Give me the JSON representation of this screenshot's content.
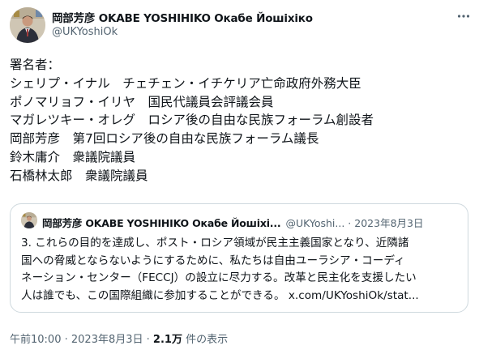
{
  "author": {
    "display_name": "岡部芳彦 OKABE YOSHIHIKO Окабе Йошіхіко",
    "handle": "@UKYoshiOk"
  },
  "body_lines": [
    "署名者：",
    "シェリプ・イナル　チェチェン・イチケリア亡命政府外務大臣",
    "ポノマリョフ・イリヤ　国民代議員会評議会員",
    "マガレツキー・オレグ　ロシア後の自由な民族フォーラム創設者",
    "岡部芳彦　第7回ロシア後の自由な民族フォーラム議長",
    "鈴木庸介　衆議院議員",
    "石橋林太郎　衆議院議員"
  ],
  "quote": {
    "display_name": "岡部芳彦 OKABE YOSHIHIKO Окабе Йошіхі...",
    "handle": "@UKYoshi...",
    "separator": "·",
    "date": "2023年8月3日",
    "text_lines": [
      "3. これらの目的を達成し、ポスト・ロシア領域が民主主義国家となり、近隣諸",
      "国への脅威とならないようにするために、私たちは自由ユーラシア・コーディ",
      "ネーション・センター（FECCJ）の設立に尽力する。改革と民主化を支援したい",
      "人は誰でも、この国際組織に参加することができる。 x.com/UKYoshiOk/stat..."
    ]
  },
  "footer": {
    "time": "午前10:00",
    "sep1": " · ",
    "date": "2023年8月3日",
    "sep2": " · ",
    "views_count": "2.1万",
    "views_label": " 件の表示"
  },
  "icons": {
    "more": "more-options-icon",
    "avatar": "profile-avatar"
  },
  "colors": {
    "text": "#0f1419",
    "secondary": "#536471",
    "border": "#cfd9de"
  }
}
